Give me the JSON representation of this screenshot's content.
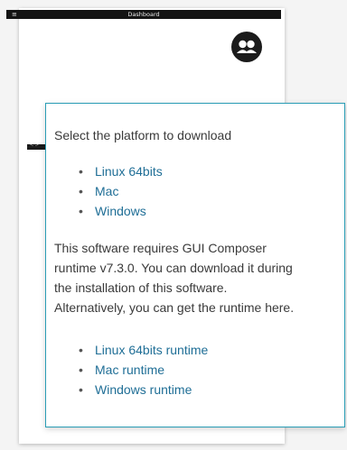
{
  "preview": {
    "header_title": "Dashboard",
    "menu_glyph": "≡",
    "strip_glyph": "< >"
  },
  "popover": {
    "intro": "Select the platform to download",
    "platforms": [
      "Linux 64bits",
      "Mac",
      "Windows"
    ],
    "note_lines": [
      "This software requires GUI Composer",
      "runtime v7.3.0. You can download it during",
      "the installation of this software.",
      "Alternatively, you can get the runtime here."
    ],
    "runtimes": [
      "Linux 64bits runtime",
      "Mac runtime",
      "Windows runtime"
    ]
  },
  "colors": {
    "link": "#1f6e96",
    "popover_border": "#2a9db5",
    "header_bg": "#141414"
  },
  "icons": {
    "avatar": "users-icon",
    "bullet": "bullet"
  }
}
